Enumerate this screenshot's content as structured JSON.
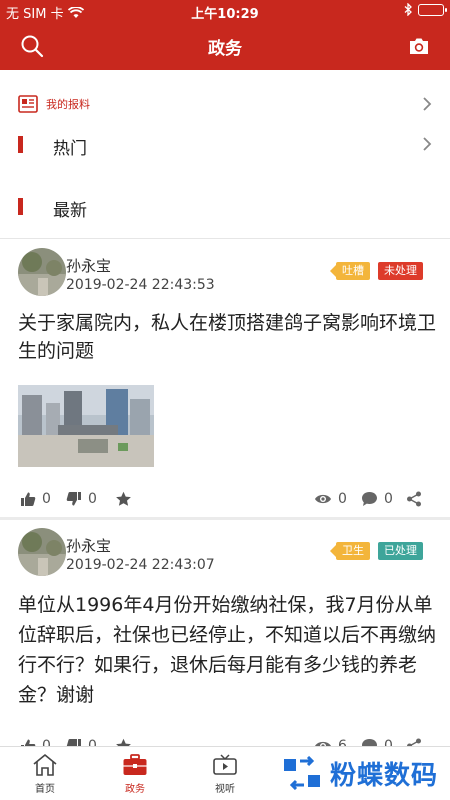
{
  "status_bar": {
    "carrier": "无 SIM 卡",
    "time": "上午10:29"
  },
  "header": {
    "title": "政务"
  },
  "menu": {
    "my_reports": "我的报料",
    "hot": "热门",
    "latest": "最新"
  },
  "posts": [
    {
      "author": "孙永宝",
      "datetime": "2019-02-24 22:43:53",
      "tags": [
        "吐槽",
        "未处理"
      ],
      "title": "关于家属院内，私人在楼顶搭建鸽子窝影响环境卫生的问题",
      "likes": "0",
      "dislikes": "0",
      "views": "0",
      "comments": "0"
    },
    {
      "author": "孙永宝",
      "datetime": "2019-02-24 22:43:07",
      "tags": [
        "卫生",
        "已处理"
      ],
      "title": "单位从1996年4月份开始缴纳社保，我7月份从单位辞职后，社保也已经停止，不知道以后不再缴纳行不行？如果行，退休后每月能有多少钱的养老金？谢谢",
      "likes": "0",
      "dislikes": "0",
      "views": "6",
      "comments": "0"
    }
  ],
  "tabbar": {
    "home": "首页",
    "gov": "政务",
    "media": "视听",
    "brand": "粉蝶数码"
  },
  "colors": {
    "primary": "#c8281e",
    "tag_yellow": "#f3b53b",
    "tag_red": "#dd3b2a",
    "tag_teal": "#3ea59a",
    "brand_blue": "#1f6fd6"
  }
}
